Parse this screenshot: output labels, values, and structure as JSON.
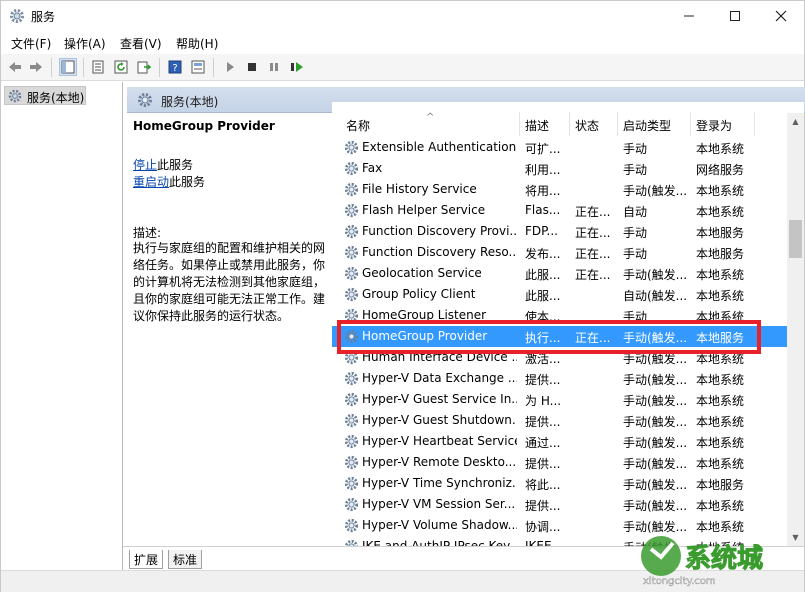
{
  "window": {
    "title": "服务"
  },
  "menu": [
    "文件(F)",
    "操作(A)",
    "查看(V)",
    "帮助(H)"
  ],
  "toolbar_icons": [
    "back-arrow-icon",
    "forward-arrow-icon",
    "console-tree-icon",
    "properties-icon",
    "refresh-icon",
    "export-icon",
    "help-icon",
    "view-icon",
    "start-icon",
    "stop-icon",
    "pause-icon",
    "restart-icon"
  ],
  "tree": {
    "root_label": "服务(本地)"
  },
  "pane": {
    "header": "服务(本地)",
    "service_title": "HomeGroup Provider",
    "stop_link": "停止",
    "stop_suffix": "此服务",
    "restart_link": "重启动",
    "restart_suffix": "此服务",
    "desc_label": "描述:",
    "desc_text": "执行与家庭组的配置和维护相关的网络任务。如果停止或禁用此服务，你的计算机将无法检测到其他家庭组，且你的家庭组可能无法正常工作。建议你保持此服务的运行状态。"
  },
  "columns": [
    "名称",
    "描述",
    "状态",
    "启动类型",
    "登录为"
  ],
  "services": [
    {
      "name": "Extensible Authentication...",
      "desc": "可扩...",
      "status": "",
      "startup": "手动",
      "logon": "本地系统"
    },
    {
      "name": "Fax",
      "desc": "利用...",
      "status": "",
      "startup": "手动",
      "logon": "网络服务"
    },
    {
      "name": "File History Service",
      "desc": "将用...",
      "status": "",
      "startup": "手动(触发...",
      "logon": "本地系统"
    },
    {
      "name": "Flash Helper Service",
      "desc": "Flas...",
      "status": "正在...",
      "startup": "自动",
      "logon": "本地系统"
    },
    {
      "name": "Function Discovery Provi...",
      "desc": "FDP...",
      "status": "正在...",
      "startup": "手动",
      "logon": "本地服务"
    },
    {
      "name": "Function Discovery Reso...",
      "desc": "发布...",
      "status": "正在...",
      "startup": "手动",
      "logon": "本地服务"
    },
    {
      "name": "Geolocation Service",
      "desc": "此服...",
      "status": "正在...",
      "startup": "手动(触发...",
      "logon": "本地系统"
    },
    {
      "name": "Group Policy Client",
      "desc": "此服...",
      "status": "",
      "startup": "自动(触发...",
      "logon": "本地系统"
    },
    {
      "name": "HomeGroup Listener",
      "desc": "使本...",
      "status": "",
      "startup": "手动",
      "logon": "本地系统"
    },
    {
      "name": "HomeGroup Provider",
      "desc": "执行...",
      "status": "正在...",
      "startup": "手动(触发...",
      "logon": "本地服务",
      "selected": true
    },
    {
      "name": "Human Interface Device ...",
      "desc": "激活...",
      "status": "",
      "startup": "手动(触发...",
      "logon": "本地系统"
    },
    {
      "name": "Hyper-V Data Exchange ...",
      "desc": "提供...",
      "status": "",
      "startup": "手动(触发...",
      "logon": "本地系统"
    },
    {
      "name": "Hyper-V Guest Service In...",
      "desc": "为 H...",
      "status": "",
      "startup": "手动(触发...",
      "logon": "本地系统"
    },
    {
      "name": "Hyper-V Guest Shutdown...",
      "desc": "提供...",
      "status": "",
      "startup": "手动(触发...",
      "logon": "本地系统"
    },
    {
      "name": "Hyper-V Heartbeat Service",
      "desc": "通过...",
      "status": "",
      "startup": "手动(触发...",
      "logon": "本地系统"
    },
    {
      "name": "Hyper-V Remote Deskto...",
      "desc": "提供...",
      "status": "",
      "startup": "手动(触发...",
      "logon": "本地系统"
    },
    {
      "name": "Hyper-V Time Synchroniz...",
      "desc": "将此...",
      "status": "",
      "startup": "手动(触发...",
      "logon": "本地服务"
    },
    {
      "name": "Hyper-V VM Session Ser...",
      "desc": "提供...",
      "status": "",
      "startup": "手动(触发...",
      "logon": "本地系统"
    },
    {
      "name": "Hyper-V Volume Shadow...",
      "desc": "协调...",
      "status": "",
      "startup": "手动(触发...",
      "logon": "本地系统"
    },
    {
      "name": "IKE and AuthIP IPsec Key...",
      "desc": "IKEE...",
      "status": "",
      "startup": "手动(触发...",
      "logon": "本地系统"
    }
  ],
  "tabs": [
    "扩展",
    "标准"
  ],
  "watermark": {
    "text": "系统城",
    "sub": "xitongcity.com"
  },
  "colors": {
    "selection": "#3399ff",
    "highlight_border": "#e8202a",
    "link": "#0645ad"
  }
}
